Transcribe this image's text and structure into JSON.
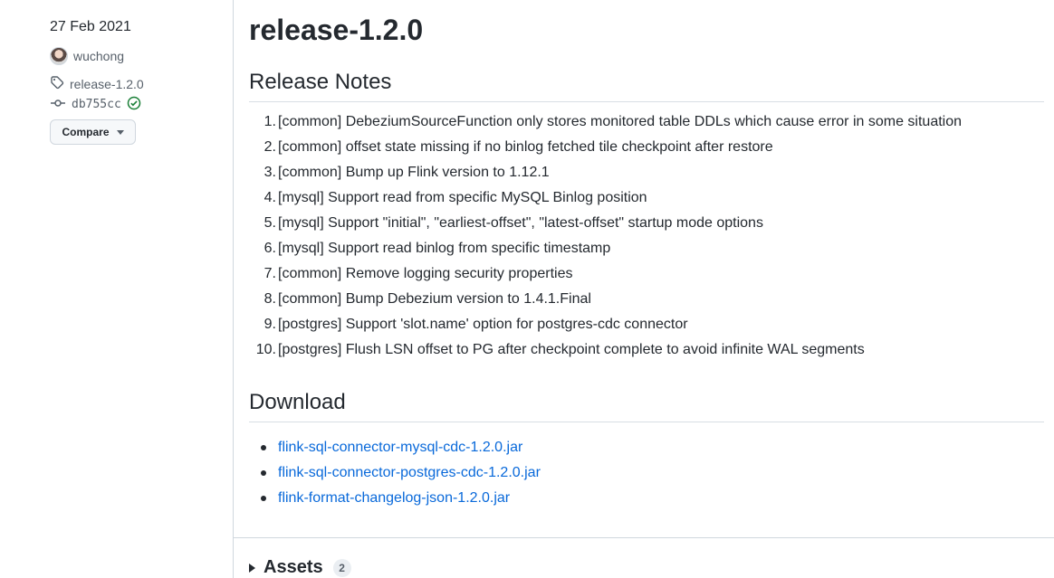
{
  "sidebar": {
    "date": "27 Feb 2021",
    "author": "wuchong",
    "tag": "release-1.2.0",
    "commit": "db755cc",
    "compare_label": "Compare",
    "icons": {
      "tag": "tag-icon",
      "commit": "commit-icon",
      "verified": "check-circle-icon",
      "caret": "caret-down-icon"
    }
  },
  "main": {
    "title": "release-1.2.0",
    "notes_heading": "Release Notes",
    "notes": [
      {
        "num": "1.",
        "text": "[common] DebeziumSourceFunction only stores monitored table DDLs which cause error in some situation"
      },
      {
        "num": "2.",
        "text": "[common] offset state missing if no binlog fetched tile checkpoint after restore"
      },
      {
        "num": "3.",
        "text": "[common] Bump up Flink version to 1.12.1"
      },
      {
        "num": "4.",
        "text": "[mysql] Support read from specific MySQL Binlog position"
      },
      {
        "num": "5.",
        "text": "[mysql] Support \"initial\", \"earliest-offset\", \"latest-offset\" startup mode options"
      },
      {
        "num": "6.",
        "text": "[mysql] Support read binlog from specific timestamp"
      },
      {
        "num": "7.",
        "text": "[common] Remove logging security properties"
      },
      {
        "num": "8.",
        "text": "[common] Bump Debezium version to 1.4.1.Final"
      },
      {
        "num": "9.",
        "text": "[postgres] Support 'slot.name' option for postgres-cdc connector"
      },
      {
        "num": "10.",
        "text": "[postgres] Flush LSN offset to PG after checkpoint complete to avoid infinite WAL segments"
      }
    ],
    "download_heading": "Download",
    "downloads": [
      "flink-sql-connector-mysql-cdc-1.2.0.jar",
      "flink-sql-connector-postgres-cdc-1.2.0.jar",
      "flink-format-changelog-json-1.2.0.jar"
    ],
    "assets_label": "Assets",
    "assets_count": "2",
    "colors": {
      "link": "#0969da",
      "verified": "#1a7f37",
      "border": "#d0d7de"
    }
  }
}
